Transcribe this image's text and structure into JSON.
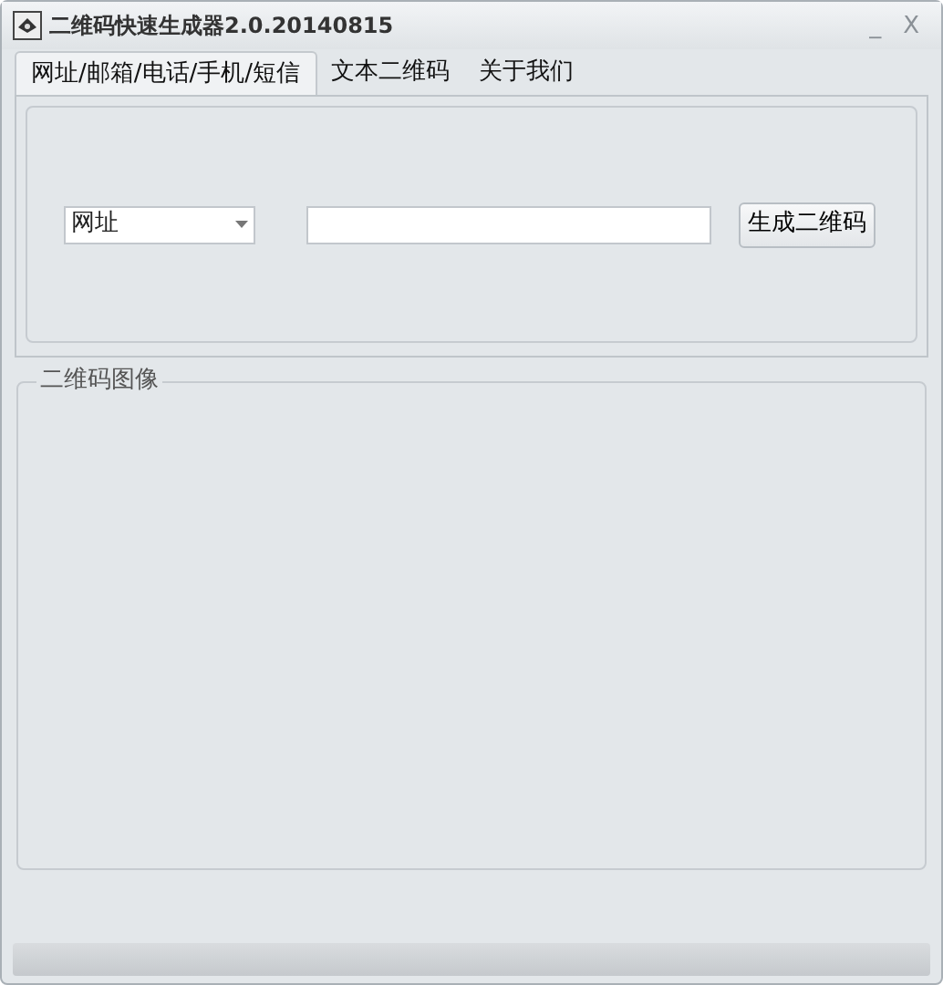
{
  "window": {
    "title": "二维码快速生成器2.0.20140815",
    "minimize": "_",
    "close": "X"
  },
  "tabs": [
    {
      "label": "网址/邮箱/电话/手机/短信",
      "selected": true
    },
    {
      "label": "文本二维码",
      "selected": false
    },
    {
      "label": "关于我们",
      "selected": false
    }
  ],
  "type_select": {
    "value": "网址"
  },
  "generate_button": "生成二维码",
  "image_group": {
    "title": "二维码图像"
  }
}
